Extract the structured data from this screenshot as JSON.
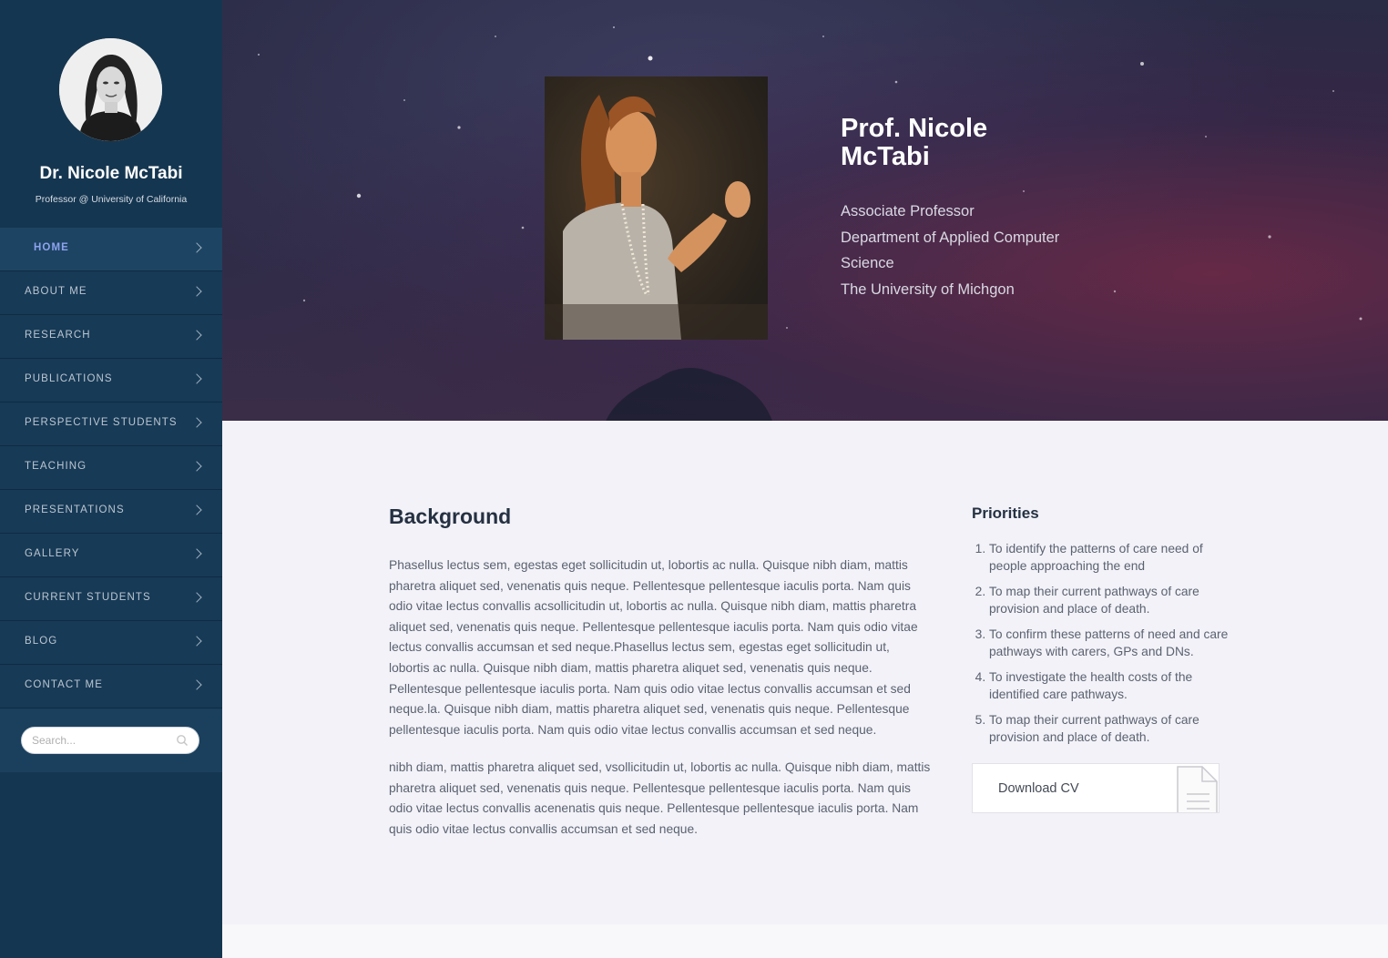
{
  "sidebar": {
    "name": "Dr. Nicole McTabi",
    "subtitle": "Professor @ University of California",
    "nav": [
      {
        "label": "HOME",
        "active": true
      },
      {
        "label": "ABOUT ME"
      },
      {
        "label": "RESEARCH"
      },
      {
        "label": "PUBLICATIONS"
      },
      {
        "label": "PERSPECTIVE STUDENTS"
      },
      {
        "label": "TEACHING"
      },
      {
        "label": "PRESENTATIONS"
      },
      {
        "label": "GALLERY"
      },
      {
        "label": "CURRENT STUDENTS"
      },
      {
        "label": "BLOG"
      },
      {
        "label": "CONTACT ME"
      }
    ],
    "search": {
      "placeholder": "Search..."
    }
  },
  "hero": {
    "name": "Prof. Nicole McTabi",
    "lines": [
      "Associate Professor",
      "Department of Applied Computer",
      "Science",
      "The University of Michgon"
    ]
  },
  "background": {
    "title": "Background",
    "paragraphs": [
      "Phasellus lectus sem, egestas eget sollicitudin ut, lobortis ac nulla. Quisque nibh diam, mattis pharetra aliquet sed, venenatis quis neque. Pellentesque pellentesque iaculis porta. Nam quis odio vitae lectus convallis acsollicitudin ut, lobortis ac nulla. Quisque nibh diam, mattis pharetra aliquet sed, venenatis quis neque. Pellentesque pellentesque iaculis porta. Nam quis odio vitae lectus convallis accumsan et sed neque.Phasellus lectus sem, egestas eget sollicitudin ut, lobortis ac nulla. Quisque nibh diam, mattis pharetra aliquet sed, venenatis quis neque. Pellentesque pellentesque iaculis porta. Nam quis odio vitae lectus convallis accumsan et sed neque.la. Quisque nibh diam, mattis pharetra aliquet sed, venenatis quis neque. Pellentesque pellentesque iaculis porta. Nam quis odio vitae lectus convallis accumsan et sed neque.",
      "nibh diam, mattis pharetra aliquet sed, vsollicitudin ut, lobortis ac nulla. Quisque nibh diam, mattis pharetra aliquet sed, venenatis quis neque. Pellentesque pellentesque iaculis porta. Nam quis odio vitae lectus convallis acenenatis quis neque. Pellentesque pellentesque iaculis porta. Nam quis odio vitae lectus convallis accumsan et sed neque."
    ]
  },
  "priorities": {
    "title": "Priorities",
    "items": [
      "To identify the patterns of care need of people approaching the end",
      "To map their current pathways of care provision and place of death.",
      "To confirm these patterns of need and care pathways with carers, GPs and DNs.",
      "To investigate the health costs of the identified care pathways.",
      "To map their current pathways of care provision and place of death."
    ],
    "download_label": "Download CV"
  }
}
